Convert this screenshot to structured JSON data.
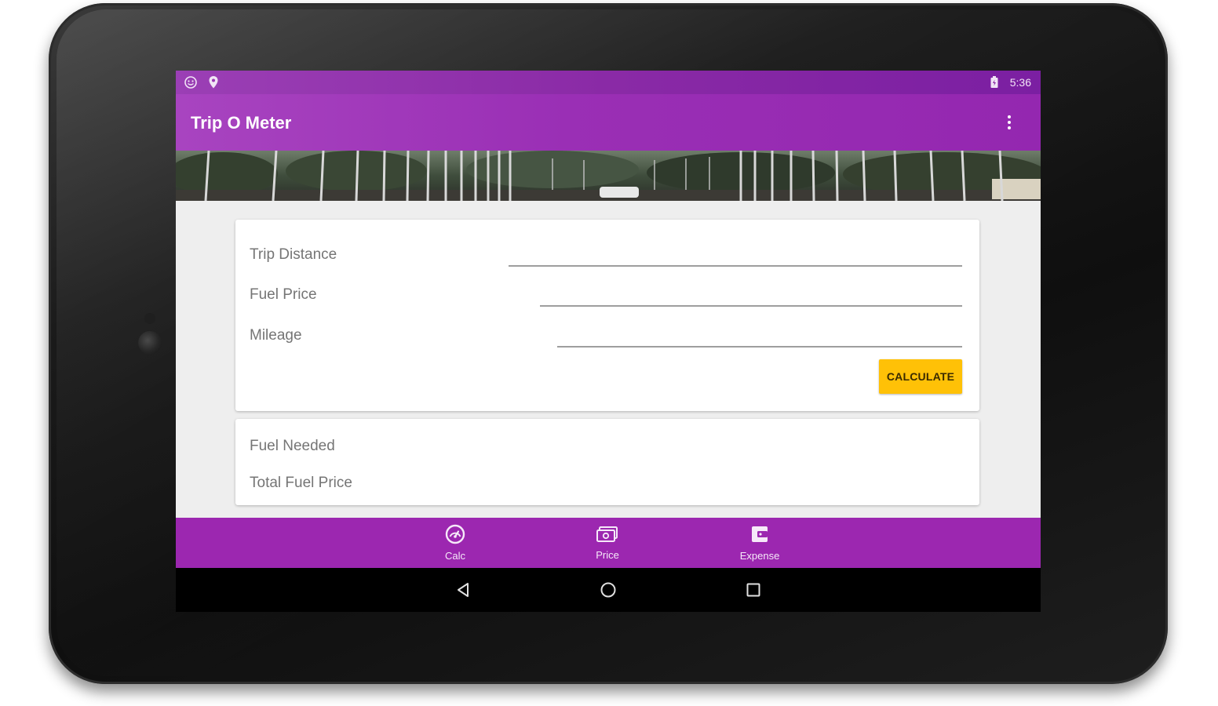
{
  "status_bar": {
    "time": "5:36",
    "icons": [
      "smiley-notification-icon",
      "location-pin-icon",
      "battery-icon"
    ]
  },
  "app_bar": {
    "title": "Trip O Meter",
    "menu_icon": "overflow-menu-icon"
  },
  "input_card": {
    "fields": [
      {
        "label": "Trip Distance",
        "value": ""
      },
      {
        "label": "Fuel Price",
        "value": ""
      },
      {
        "label": "Mileage",
        "value": ""
      }
    ],
    "calculate_label": "CALCULATE"
  },
  "output_card": {
    "rows": [
      {
        "label": "Fuel Needed"
      },
      {
        "label": "Total Fuel Price"
      }
    ]
  },
  "bottom_nav": {
    "items": [
      {
        "label": "Calc",
        "icon": "speedometer-icon"
      },
      {
        "label": "Price",
        "icon": "money-icon"
      },
      {
        "label": "Expense",
        "icon": "wallet-icon"
      }
    ]
  },
  "system_nav": {
    "buttons": [
      "back-icon",
      "home-icon",
      "recents-icon"
    ]
  },
  "colors": {
    "primary": "#9c27b0",
    "accent": "#ffc107",
    "background": "#eeeeee"
  }
}
